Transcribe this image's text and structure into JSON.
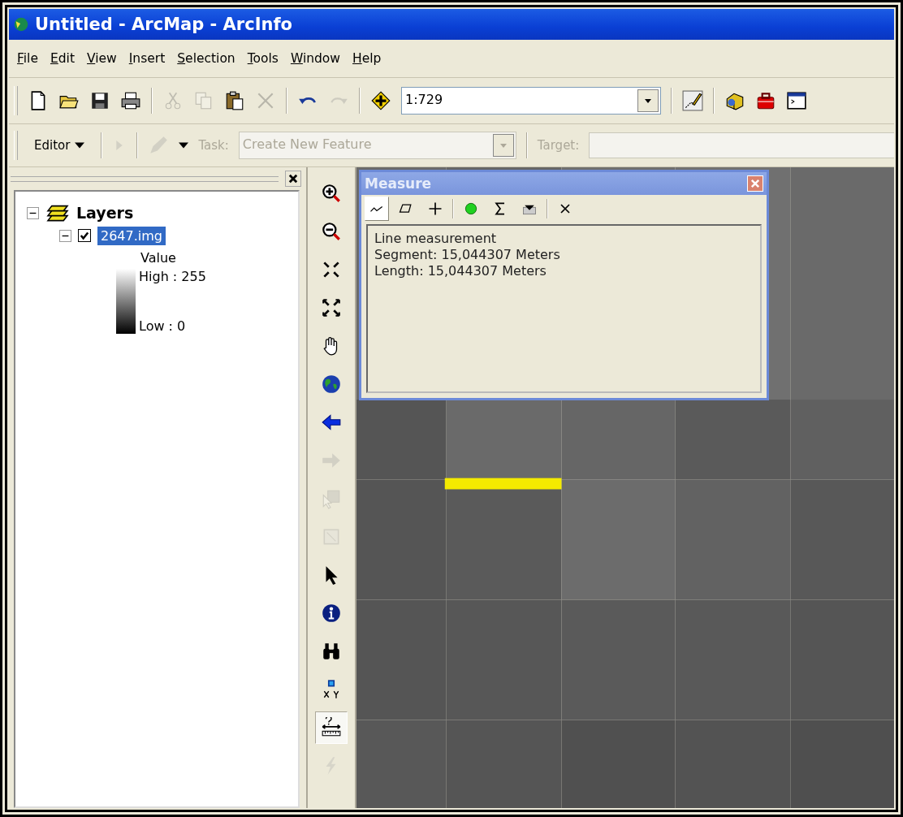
{
  "window": {
    "title": "Untitled - ArcMap - ArcInfo"
  },
  "menu": [
    "File",
    "Edit",
    "View",
    "Insert",
    "Selection",
    "Tools",
    "Window",
    "Help"
  ],
  "standard_toolbar": {
    "scale": "1:729",
    "tools": [
      {
        "kind": "new",
        "disabled": false
      },
      {
        "kind": "open",
        "disabled": false
      },
      {
        "kind": "save",
        "disabled": false
      },
      {
        "kind": "print",
        "disabled": false
      },
      {
        "kind": "separator"
      },
      {
        "kind": "cut",
        "disabled": true
      },
      {
        "kind": "copy",
        "disabled": true
      },
      {
        "kind": "paste",
        "disabled": false
      },
      {
        "kind": "delete",
        "disabled": true
      },
      {
        "kind": "separator"
      },
      {
        "kind": "undo",
        "disabled": false
      },
      {
        "kind": "redo",
        "disabled": true
      },
      {
        "kind": "separator"
      },
      {
        "kind": "add_data",
        "disabled": false
      },
      {
        "kind": "scale"
      },
      {
        "kind": "separator"
      },
      {
        "kind": "editor",
        "disabled": false
      },
      {
        "kind": "separator"
      },
      {
        "kind": "catalog",
        "disabled": false
      },
      {
        "kind": "toolbox",
        "disabled": false
      },
      {
        "kind": "command",
        "disabled": false
      }
    ]
  },
  "editor_toolbar": {
    "menu": "Editor",
    "task_label": "Task:",
    "task_value": "Create New Feature",
    "target_label": "Target:",
    "disabled": true
  },
  "table_of_contents": {
    "layers": [
      {
        "label": "Layers",
        "expanded": true,
        "children": [
          {
            "label": "2647.img",
            "checked": true,
            "selected": true,
            "expanded": true,
            "legend": {
              "field": "Value",
              "high": "High : 255",
              "low": "Low : 0"
            }
          }
        ]
      }
    ]
  },
  "tools_toolbar": [
    {
      "kind": "zoom_in",
      "disabled": false,
      "selected": false
    },
    {
      "kind": "zoom_out",
      "disabled": false,
      "selected": false
    },
    {
      "kind": "fixed_in",
      "disabled": false,
      "selected": false
    },
    {
      "kind": "fixed_out",
      "disabled": false,
      "selected": false
    },
    {
      "kind": "pan",
      "disabled": false,
      "selected": false
    },
    {
      "kind": "full_extent",
      "disabled": false,
      "selected": false
    },
    {
      "kind": "back",
      "disabled": false,
      "selected": false
    },
    {
      "kind": "forward",
      "disabled": true,
      "selected": false
    },
    {
      "kind": "select_features",
      "disabled": true,
      "selected": false
    },
    {
      "kind": "clear_selection",
      "disabled": true,
      "selected": false
    },
    {
      "kind": "select",
      "disabled": false,
      "selected": false
    },
    {
      "kind": "identify",
      "disabled": false,
      "selected": false
    },
    {
      "kind": "find",
      "disabled": false,
      "selected": false
    },
    {
      "kind": "goto_xy",
      "disabled": false,
      "selected": false
    },
    {
      "kind": "measure",
      "disabled": false,
      "selected": true
    },
    {
      "kind": "hyperlink",
      "disabled": true,
      "selected": false
    }
  ],
  "measure_dialog": {
    "title": "Measure",
    "tools": [
      {
        "kind": "line",
        "selected": true
      },
      {
        "kind": "area",
        "selected": false
      },
      {
        "kind": "feature",
        "selected": false
      },
      {
        "kind": "separator"
      },
      {
        "kind": "snap",
        "selected": false
      },
      {
        "kind": "sum",
        "selected": false
      },
      {
        "kind": "units",
        "selected": false
      },
      {
        "kind": "separator"
      },
      {
        "kind": "clear",
        "selected": false
      }
    ],
    "lines": [
      "Line measurement",
      "Segment: 15,044307 Meters",
      "Length: 15,044307 Meters"
    ]
  },
  "map": {
    "kind": "picture"
  }
}
